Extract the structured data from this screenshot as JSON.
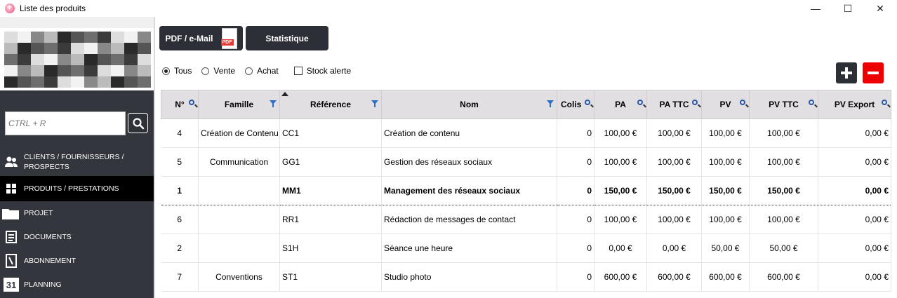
{
  "window": {
    "title": "Liste des produits",
    "minimize": "—",
    "maximize": "☐",
    "close": "✕"
  },
  "sidebar": {
    "search_placeholder": "CTRL + R",
    "nav": [
      {
        "label": "CLIENTS / FOURNISSEURS /",
        "label2": "PROSPECTS",
        "icon": "users-icon"
      },
      {
        "label": "PRODUITS / PRESTATIONS",
        "icon": "grid-icon"
      },
      {
        "label": "PROJET",
        "icon": "folder-icon"
      },
      {
        "label": "DOCUMENTS",
        "icon": "document-icon"
      },
      {
        "label": "ABONNEMENT",
        "icon": "subscription-icon"
      },
      {
        "label": "PLANNING",
        "icon": "calendar-icon",
        "icon_text": "31"
      }
    ]
  },
  "toolbar": {
    "pdf_label": "PDF / e-Mail",
    "pdf_tag": "PDF",
    "stats_label": "Statistique"
  },
  "filters": {
    "radios": [
      {
        "label": "Tous",
        "checked": true
      },
      {
        "label": "Vente",
        "checked": false
      },
      {
        "label": "Achat",
        "checked": false
      }
    ],
    "stock_label": "Stock alerte",
    "stock_checked": false
  },
  "table": {
    "columns": [
      "N°",
      "Famille",
      "Référence",
      "Nom",
      "Colis",
      "PA",
      "PA TTC",
      "PV",
      "PV TTC",
      "PV Export"
    ],
    "rows": [
      {
        "n": "4",
        "famille": "Création de Contenu",
        "ref": "CC1",
        "nom": "Création de contenu",
        "colis": "0",
        "pa": "100,00 €",
        "pa_ttc": "100,00 €",
        "pv": "100,00 €",
        "pv_ttc": "100,00 €",
        "pv_export": "0,00 €",
        "selected": false
      },
      {
        "n": "5",
        "famille": "Communication",
        "ref": "GG1",
        "nom": "Gestion des réseaux sociaux",
        "colis": "0",
        "pa": "100,00 €",
        "pa_ttc": "100,00 €",
        "pv": "100,00 €",
        "pv_ttc": "100,00 €",
        "pv_export": "0,00 €",
        "selected": false
      },
      {
        "n": "1",
        "famille": "",
        "ref": "MM1",
        "nom": "Management des réseaux sociaux",
        "colis": "0",
        "pa": "150,00 €",
        "pa_ttc": "150,00 €",
        "pv": "150,00 €",
        "pv_ttc": "150,00 €",
        "pv_export": "0,00 €",
        "selected": true
      },
      {
        "n": "6",
        "famille": "",
        "ref": "RR1",
        "nom": "Rédaction de messages de contact",
        "colis": "0",
        "pa": "100,00 €",
        "pa_ttc": "100,00 €",
        "pv": "100,00 €",
        "pv_ttc": "100,00 €",
        "pv_export": "0,00 €",
        "selected": false
      },
      {
        "n": "2",
        "famille": "",
        "ref": "S1H",
        "nom": "Séance une heure",
        "colis": "0",
        "pa": "0,00 €",
        "pa_ttc": "0,00 €",
        "pv": "50,00 €",
        "pv_ttc": "50,00 €",
        "pv_export": "0,00 €",
        "selected": false
      },
      {
        "n": "7",
        "famille": "Conventions",
        "ref": "ST1",
        "nom": "Studio photo",
        "colis": "0",
        "pa": "600,00 €",
        "pa_ttc": "600,00 €",
        "pv": "600,00 €",
        "pv_ttc": "600,00 €",
        "pv_export": "0,00 €",
        "selected": false
      }
    ]
  },
  "colors": {
    "dark": "#34363d",
    "header_bg": "#e2dfe3",
    "delete": "#ef0000",
    "accent_blue": "#2b6fc9"
  }
}
